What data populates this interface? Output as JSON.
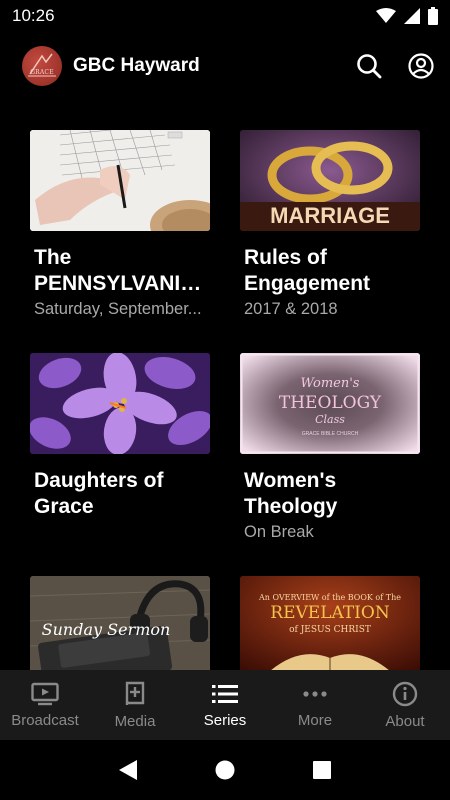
{
  "status": {
    "time": "10:26"
  },
  "app": {
    "title": "GBC Hayward",
    "logo_text": "GRACE"
  },
  "series": [
    {
      "title": "The PENNSYLVANIA...",
      "subtitle": "Saturday, September..."
    },
    {
      "title": "Rules of Engagement",
      "subtitle": "2017 & 2018",
      "thumb_text": "MARRIAGE"
    },
    {
      "title": "Daughters of Grace",
      "subtitle": ""
    },
    {
      "title": "Women's Theology",
      "subtitle": "On Break",
      "thumb_line1": "Women's",
      "thumb_line2": "THEOLOGY",
      "thumb_line3": "Class",
      "thumb_line4": "GRACE BIBLE CHURCH"
    },
    {
      "title": "",
      "subtitle": "",
      "thumb_text": "Sunday Sermon"
    },
    {
      "title": "",
      "subtitle": "",
      "thumb_line1": "An OVERVIEW of the BOOK of The",
      "thumb_line2": "REVELATION",
      "thumb_line3": "of JESUS CHRIST"
    }
  ],
  "nav": [
    {
      "label": "Broadcast",
      "icon": "tv-icon"
    },
    {
      "label": "Media",
      "icon": "book-plus-icon"
    },
    {
      "label": "Series",
      "icon": "list-icon"
    },
    {
      "label": "More",
      "icon": "more-horiz-icon"
    },
    {
      "label": "About",
      "icon": "info-icon"
    }
  ],
  "colors": {
    "background": "#000000",
    "nav_background": "#1a1a1a",
    "active": "#ffffff",
    "inactive": "#8a8a8a",
    "subtitle": "#a9a9a9"
  }
}
